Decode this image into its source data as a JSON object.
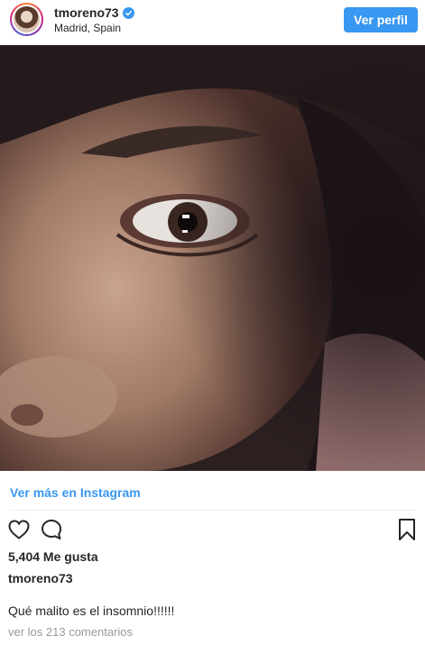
{
  "header": {
    "username": "tmoreno73",
    "location": "Madrid, Spain",
    "view_profile_label": "Ver perfil",
    "verified_icon": "verified-badge-icon"
  },
  "post": {
    "image_icon": "post-photo"
  },
  "footer": {
    "view_more_label": "Ver más en Instagram",
    "likes_text": "5,404 Me gusta",
    "caption_username": "tmoreno73",
    "caption_text": "Qué malito es el insomnio!!!!!!",
    "comments_link_text": "ver los 213 comentarios",
    "icons": {
      "like": "heart-icon",
      "comment": "comment-icon",
      "save": "bookmark-icon"
    }
  },
  "colors": {
    "accent": "#3897f0",
    "text": "#262626",
    "muted": "#999999",
    "divider": "#efefef"
  }
}
